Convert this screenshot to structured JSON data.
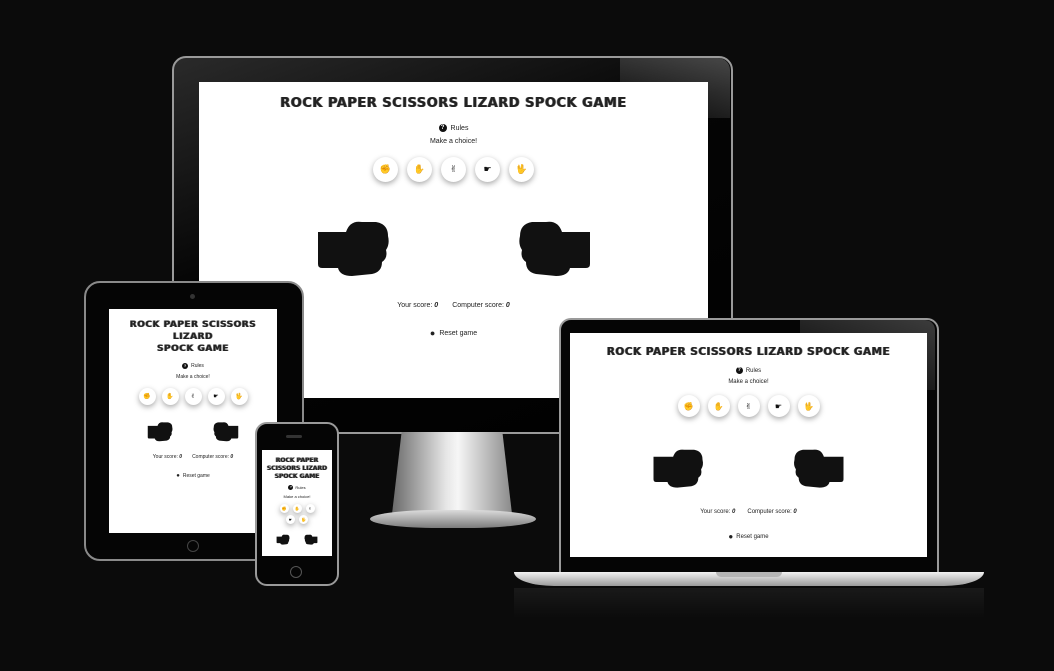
{
  "game": {
    "title": "ROCK PAPER SCISSORS LIZARD SPOCK GAME",
    "title_lines": [
      "ROCK PAPER SCISSORS LIZARD",
      "SPOCK GAME"
    ],
    "title_lines_phone": [
      "ROCK PAPER",
      "SCISSORS LIZARD",
      "SPOCK GAME"
    ],
    "rules_label": "Rules",
    "rules_icon": "?",
    "make_choice": "Make a choice!",
    "choices": [
      {
        "name": "rock",
        "glyph": "✊"
      },
      {
        "name": "paper",
        "glyph": "✋"
      },
      {
        "name": "scissors",
        "glyph": "✌"
      },
      {
        "name": "lizard",
        "glyph": "☛"
      },
      {
        "name": "spock",
        "glyph": "🖖"
      }
    ],
    "your_score_label": "Your score:",
    "your_score": "0",
    "computer_score_label": "Computer score:",
    "computer_score": "0",
    "reset_label": "Reset game",
    "reset_icon": "bomb-icon"
  },
  "colors": {
    "background": "#0b0b0b",
    "screen": "#ffffff",
    "text": "#222222",
    "hand": "#111111"
  }
}
